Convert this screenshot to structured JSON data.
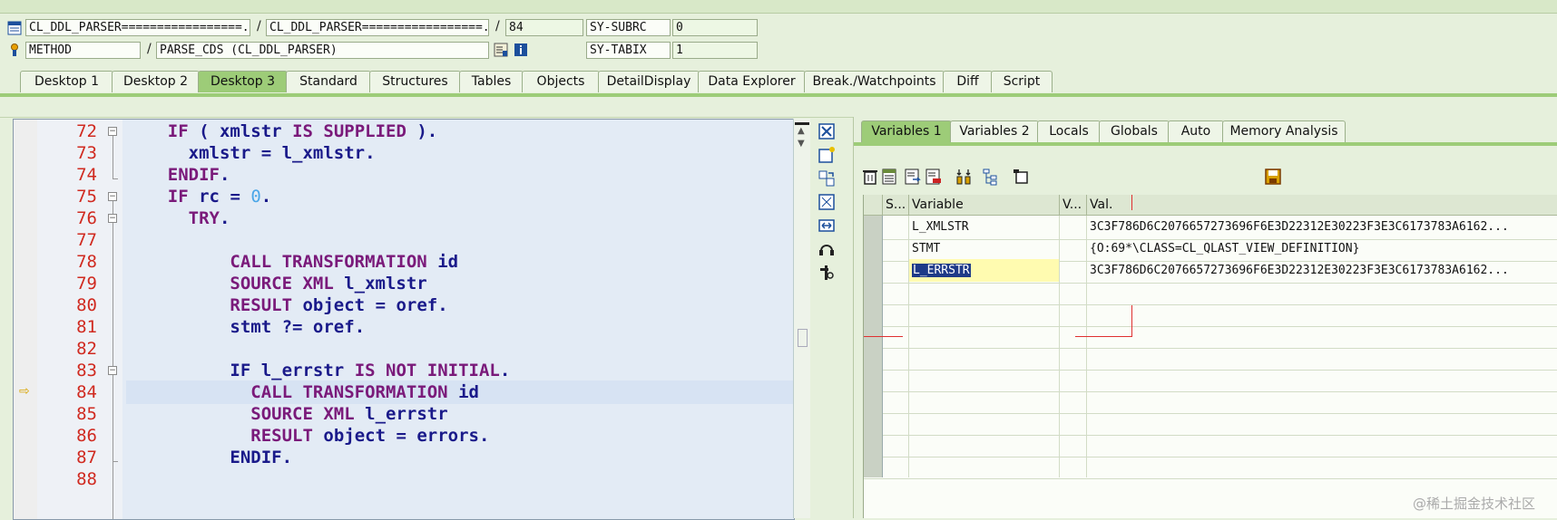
{
  "header": {
    "row1": {
      "program": "CL_DDL_PARSER=================...",
      "include": "CL_DDL_PARSER=================...",
      "line": "84",
      "sys_label": "SY-SUBRC",
      "sys_value": "0"
    },
    "row2": {
      "event_type": "METHOD",
      "event": "PARSE_CDS (CL_DDL_PARSER)",
      "sys_label": "SY-TABIX",
      "sys_value": "1"
    },
    "separator": "/"
  },
  "desktop_tabs": [
    {
      "label": "Desktop 1",
      "active": false
    },
    {
      "label": "Desktop 2",
      "active": false
    },
    {
      "label": "Desktop 3",
      "active": true
    },
    {
      "label": "Standard",
      "active": false
    },
    {
      "label": "Structures",
      "active": false
    },
    {
      "label": "Tables",
      "active": false
    },
    {
      "label": "Objects",
      "active": false
    },
    {
      "label": "DetailDisplay",
      "active": false
    },
    {
      "label": "Data Explorer",
      "active": false
    },
    {
      "label": "Break./Watchpoints",
      "active": false
    },
    {
      "label": "Diff",
      "active": false
    },
    {
      "label": "Script",
      "active": false
    }
  ],
  "code": {
    "current_line": "84",
    "lines": [
      {
        "num": "72",
        "text": "IF ( xmlstr IS SUPPLIED )."
      },
      {
        "num": "73",
        "text": "xmlstr = l_xmlstr."
      },
      {
        "num": "74",
        "text": "ENDIF."
      },
      {
        "num": "75",
        "text": "IF rc = 0."
      },
      {
        "num": "76",
        "text": "TRY."
      },
      {
        "num": "77",
        "text": ""
      },
      {
        "num": "78",
        "text": "CALL TRANSFORMATION id"
      },
      {
        "num": "79",
        "text": "SOURCE XML l_xmlstr"
      },
      {
        "num": "80",
        "text": "RESULT object = oref."
      },
      {
        "num": "81",
        "text": "stmt ?= oref."
      },
      {
        "num": "82",
        "text": ""
      },
      {
        "num": "83",
        "text": "IF l_errstr IS NOT INITIAL."
      },
      {
        "num": "84",
        "text": "CALL TRANSFORMATION id"
      },
      {
        "num": "85",
        "text": "SOURCE XML l_errstr"
      },
      {
        "num": "86",
        "text": "RESULT object = errors."
      },
      {
        "num": "87",
        "text": "ENDIF."
      },
      {
        "num": "88",
        "text": ""
      }
    ]
  },
  "variables_panel": {
    "tabs": [
      {
        "label": "Variables 1",
        "active": true
      },
      {
        "label": "Variables 2",
        "active": false
      },
      {
        "label": "Locals",
        "active": false
      },
      {
        "label": "Globals",
        "active": false
      },
      {
        "label": "Auto",
        "active": false
      },
      {
        "label": "Memory Analysis",
        "active": false
      }
    ],
    "columns": {
      "s": "S...",
      "variable": "Variable",
      "v": "V...",
      "value": "Val."
    },
    "rows": [
      {
        "variable": "L_XMLSTR",
        "value": "3C3F786D6C2076657273696F6E3D22312E30223F3E3C6173783A6162..."
      },
      {
        "variable": "STMT",
        "value": "{O:69*\\CLASS=CL_QLAST_VIEW_DEFINITION}"
      },
      {
        "variable": "L_ERRSTR",
        "value": "3C3F786D6C2076657273696F6E3D22312E30223F3E3C6173783A6162..."
      }
    ],
    "empty_rows": 9
  },
  "watermark": "@稀土掘金技术社区"
}
